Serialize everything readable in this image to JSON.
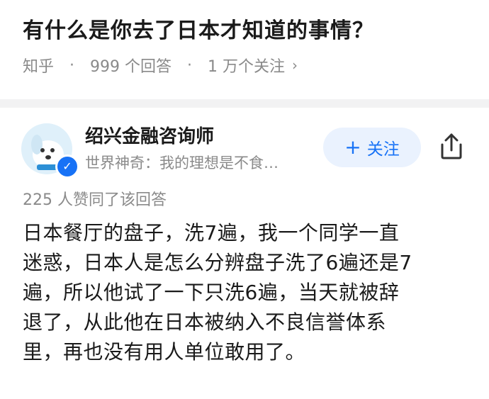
{
  "question": {
    "title": "有什么是你去了日本才知道的事情？",
    "source": "知乎",
    "answers": "999 个回答",
    "followers": "1 万个关注",
    "separator": "·",
    "chevron": "›"
  },
  "author": {
    "name": "绍兴金融咨询师",
    "bio": "世界神奇：我的理想是不食…",
    "avatar_icon": "dog-avatar-icon",
    "verified_icon": "verified-check-icon",
    "follow_label": "关注",
    "follow_plus": "+"
  },
  "answer": {
    "votes": "225 人赞同了该回答",
    "lines": [
      "日本餐厅的盘子，洗7遍，我一个同学一直",
      "迷惑，日本人是怎么分辨盘子洗了6遍还是7",
      "遍，所以他试了一下只洗6遍，当天就被辞",
      "退了，从此他在日本被纳入不良信誉体系",
      "里，再也没有用人单位敢用了。"
    ]
  },
  "colors": {
    "accent": "#1772f6",
    "follow_bg": "#eaf2fe",
    "meta_gray": "#8a8a8a",
    "divider": "#f2f2f3"
  }
}
